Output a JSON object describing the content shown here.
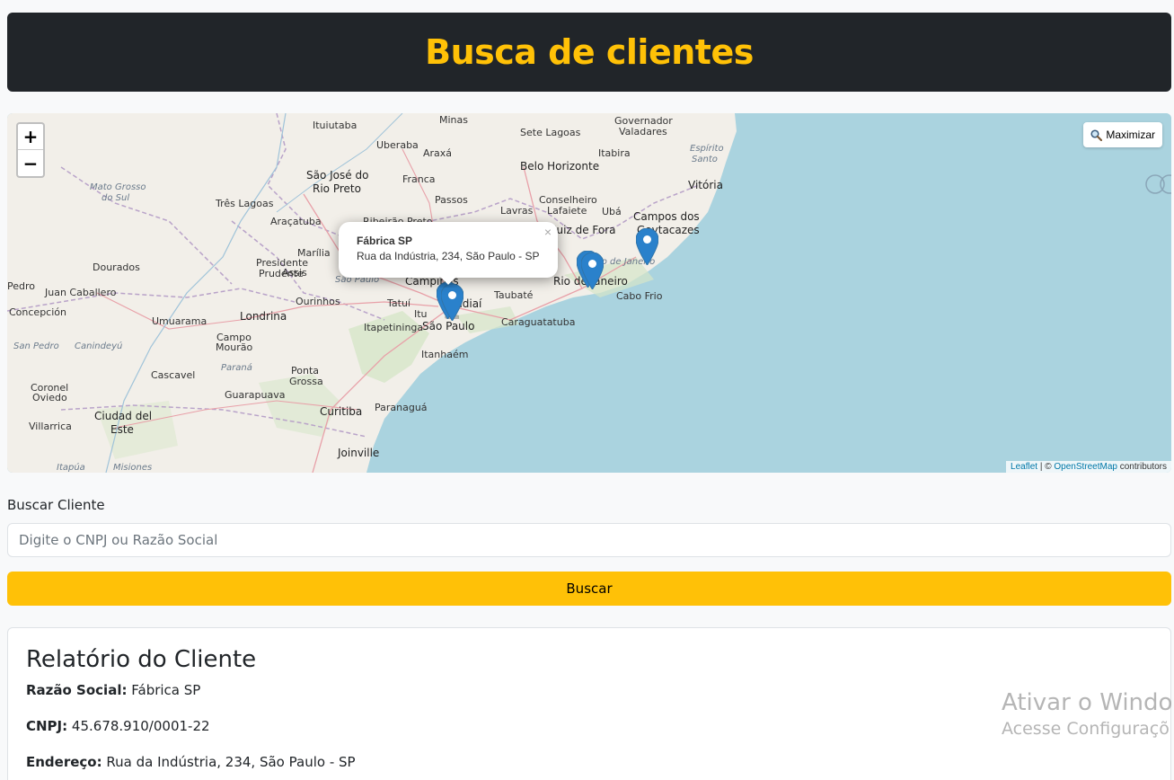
{
  "header": {
    "title": "Busca de clientes"
  },
  "map": {
    "zoom_in": "+",
    "zoom_out": "−",
    "maximize_label": "Maximizar",
    "labels": [
      {
        "text": "Ituiutaba",
        "cls": ""
      },
      {
        "text": "Minas",
        "cls": ""
      },
      {
        "text": "Governador",
        "cls": ""
      },
      {
        "text": "Valadares",
        "cls": ""
      },
      {
        "text": "Uberaba",
        "cls": ""
      },
      {
        "text": "Sete Lagoas",
        "cls": ""
      },
      {
        "text": "Araxá",
        "cls": ""
      },
      {
        "text": "Itabira",
        "cls": ""
      },
      {
        "text": "Espírito",
        "cls": "it"
      },
      {
        "text": "Santo",
        "cls": "it"
      },
      {
        "text": "Mato Grosso",
        "cls": "it"
      },
      {
        "text": "do Sul",
        "cls": "it"
      },
      {
        "text": "São José do",
        "cls": "big"
      },
      {
        "text": "Rio Preto",
        "cls": "big"
      },
      {
        "text": "Franca",
        "cls": ""
      },
      {
        "text": "Belo Horizonte",
        "cls": "big"
      },
      {
        "text": "Vitória",
        "cls": "big"
      },
      {
        "text": "Três Lagoas",
        "cls": ""
      },
      {
        "text": "Passos",
        "cls": ""
      },
      {
        "text": "Lavras",
        "cls": ""
      },
      {
        "text": "Conselheiro",
        "cls": ""
      },
      {
        "text": "Lafaiete",
        "cls": ""
      },
      {
        "text": "Ubá",
        "cls": ""
      },
      {
        "text": "Araçatuba",
        "cls": ""
      },
      {
        "text": "Ribeirão Preto",
        "cls": ""
      },
      {
        "text": "Campos dos",
        "cls": "big"
      },
      {
        "text": "Goytacazes",
        "cls": "big"
      },
      {
        "text": "Juiz de Fora",
        "cls": "big"
      },
      {
        "text": "Marília",
        "cls": ""
      },
      {
        "text": "Presidente",
        "cls": ""
      },
      {
        "text": "Prudente",
        "cls": ""
      },
      {
        "text": "Assis",
        "cls": ""
      },
      {
        "text": "Dourados",
        "cls": ""
      },
      {
        "text": "São Paulo",
        "cls": "it"
      },
      {
        "text": "Rio de Janeiro",
        "cls": "it"
      },
      {
        "text": "Pedro",
        "cls": ""
      },
      {
        "text": "Juan Caballero",
        "cls": ""
      },
      {
        "text": "Campinas",
        "cls": "big"
      },
      {
        "text": "Rio de Janeiro",
        "cls": "big"
      },
      {
        "text": "Cabo Frio",
        "cls": ""
      },
      {
        "text": "Ourinhos",
        "cls": ""
      },
      {
        "text": "Tatuí",
        "cls": ""
      },
      {
        "text": "Itu",
        "cls": ""
      },
      {
        "text": "Jundiaí",
        "cls": "big"
      },
      {
        "text": "Taubaté",
        "cls": ""
      },
      {
        "text": "Concepción",
        "cls": ""
      },
      {
        "text": "Londrina",
        "cls": "big"
      },
      {
        "text": "Umuarama",
        "cls": ""
      },
      {
        "text": "Itapetininga",
        "cls": ""
      },
      {
        "text": "São Paulo",
        "cls": "big"
      },
      {
        "text": "Caraguatatuba",
        "cls": ""
      },
      {
        "text": "San Pedro",
        "cls": "it"
      },
      {
        "text": "Canindeyú",
        "cls": "it"
      },
      {
        "text": "Campo",
        "cls": ""
      },
      {
        "text": "Mourão",
        "cls": ""
      },
      {
        "text": "Itanhaém",
        "cls": ""
      },
      {
        "text": "Paraná",
        "cls": "it"
      },
      {
        "text": "Cascavel",
        "cls": ""
      },
      {
        "text": "Ponta",
        "cls": ""
      },
      {
        "text": "Grossa",
        "cls": ""
      },
      {
        "text": "Coronel",
        "cls": ""
      },
      {
        "text": "Oviedo",
        "cls": ""
      },
      {
        "text": "Guarapuava",
        "cls": ""
      },
      {
        "text": "Paranaguá",
        "cls": ""
      },
      {
        "text": "Curitiba",
        "cls": "big"
      },
      {
        "text": "Ciudad del",
        "cls": "big"
      },
      {
        "text": "Este",
        "cls": "big"
      },
      {
        "text": "Villarrica",
        "cls": ""
      },
      {
        "text": "Joinville",
        "cls": "big"
      },
      {
        "text": "Itapúa",
        "cls": "it"
      },
      {
        "text": "Misiones",
        "cls": "it"
      }
    ],
    "popup": {
      "title": "Fábrica SP",
      "address": "Rua da Indústria, 234, São Paulo - SP",
      "close": "×"
    },
    "attribution": {
      "leaflet": "Leaflet",
      "separator": " | © ",
      "osm": "OpenStreetMap",
      "suffix": " contributors"
    }
  },
  "search": {
    "label": "Buscar Cliente",
    "placeholder": "Digite o CNPJ ou Razão Social",
    "button": "Buscar"
  },
  "report": {
    "title": "Relatório do Cliente",
    "razao_label": "Razão Social:",
    "razao_value": "Fábrica SP",
    "cnpj_label": "CNPJ:",
    "cnpj_value": "45.678.910/0001-22",
    "endereco_label": "Endereço:",
    "endereco_value": "Rua da Indústria, 234, São Paulo - SP"
  },
  "watermark": {
    "line1": "Ativar o Windo",
    "line2": "Acesse Configuraçõ"
  },
  "colors": {
    "header_bg": "#212529",
    "accent": "#ffc107",
    "ocean": "#aad3df",
    "land": "#f2efe9",
    "marker": "#2a81cb"
  }
}
